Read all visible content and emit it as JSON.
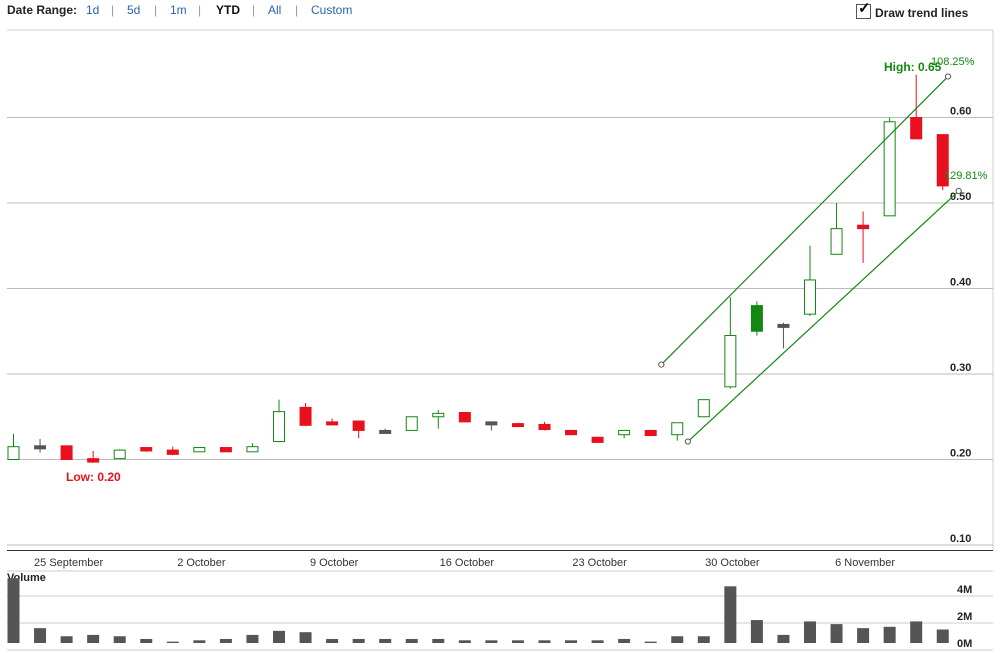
{
  "toolbar": {
    "date_range_label": "Date Range:",
    "ranges": [
      {
        "label": "1d"
      },
      {
        "label": "5d"
      },
      {
        "label": "1m"
      },
      {
        "label": "YTD",
        "active": true
      },
      {
        "label": "All"
      },
      {
        "label": "Custom"
      }
    ],
    "trend_toggle_label": "Draw trend lines",
    "trend_toggle_checked": true
  },
  "colors": {
    "up": "#118811",
    "down": "#e8101c",
    "flat": "#555555",
    "grid": "#bbbbbb",
    "volume": "#555555",
    "trend": "#118811"
  },
  "chart_data": {
    "type": "candlestick",
    "volume_label": "Volume",
    "price_axis": {
      "ticks": [
        "0.60",
        "0.50",
        "0.40",
        "0.30",
        "0.20",
        "0.10"
      ],
      "ylim": [
        0.1,
        0.7
      ]
    },
    "volume_axis": {
      "ticks": [
        "4M",
        "2M",
        "0M"
      ],
      "ylim": [
        0,
        5
      ]
    },
    "x_labels": [
      "25 September",
      "2 October",
      "9 October",
      "16 October",
      "23 October",
      "30 October",
      "6 November"
    ],
    "low_label": "Low: 0.20",
    "high_label": "High: 0.65",
    "annotations": [
      "108.25%",
      "129.81%"
    ],
    "trend_lines": [
      {
        "from": {
          "day": 24.4,
          "price": 0.311
        },
        "to": {
          "day": 35.2,
          "price": 0.648
        }
      },
      {
        "from": {
          "day": 25.4,
          "price": 0.221
        },
        "to": {
          "day": 35.6,
          "price": 0.514
        }
      }
    ],
    "candles": [
      {
        "o": 0.2,
        "h": 0.23,
        "l": 0.2,
        "c": 0.215,
        "v": 4.8
      },
      {
        "o": 0.216,
        "h": 0.224,
        "l": 0.208,
        "c": 0.216,
        "v": 1.1
      },
      {
        "o": 0.216,
        "h": 0.216,
        "l": 0.2,
        "c": 0.2,
        "v": 0.5
      },
      {
        "o": 0.201,
        "h": 0.21,
        "l": 0.196,
        "c": 0.197,
        "v": 0.6
      },
      {
        "o": 0.201,
        "h": 0.212,
        "l": 0.201,
        "c": 0.211,
        "v": 0.5
      },
      {
        "o": 0.214,
        "h": 0.214,
        "l": 0.209,
        "c": 0.21,
        "v": 0.3
      },
      {
        "o": 0.211,
        "h": 0.215,
        "l": 0.205,
        "c": 0.206,
        "v": 0.1
      },
      {
        "o": 0.209,
        "h": 0.214,
        "l": 0.209,
        "c": 0.214,
        "v": 0.2
      },
      {
        "o": 0.214,
        "h": 0.214,
        "l": 0.209,
        "c": 0.209,
        "v": 0.3
      },
      {
        "o": 0.209,
        "h": 0.219,
        "l": 0.209,
        "c": 0.215,
        "v": 0.6
      },
      {
        "o": 0.221,
        "h": 0.27,
        "l": 0.22,
        "c": 0.256,
        "v": 0.9
      },
      {
        "o": 0.261,
        "h": 0.266,
        "l": 0.239,
        "c": 0.24,
        "v": 0.8
      },
      {
        "o": 0.244,
        "h": 0.248,
        "l": 0.241,
        "c": 0.241,
        "v": 0.3
      },
      {
        "o": 0.245,
        "h": 0.245,
        "l": 0.225,
        "c": 0.234,
        "v": 0.3
      },
      {
        "o": 0.234,
        "h": 0.236,
        "l": 0.231,
        "c": 0.234,
        "v": 0.3
      },
      {
        "o": 0.234,
        "h": 0.25,
        "l": 0.234,
        "c": 0.25,
        "v": 0.3
      },
      {
        "o": 0.25,
        "h": 0.258,
        "l": 0.236,
        "c": 0.254,
        "v": 0.3
      },
      {
        "o": 0.255,
        "h": 0.255,
        "l": 0.244,
        "c": 0.244,
        "v": 0.2
      },
      {
        "o": 0.244,
        "h": 0.244,
        "l": 0.234,
        "c": 0.244,
        "v": 0.2
      },
      {
        "o": 0.242,
        "h": 0.243,
        "l": 0.238,
        "c": 0.24,
        "v": 0.2
      },
      {
        "o": 0.241,
        "h": 0.244,
        "l": 0.234,
        "c": 0.235,
        "v": 0.2
      },
      {
        "o": 0.234,
        "h": 0.234,
        "l": 0.229,
        "c": 0.229,
        "v": 0.2
      },
      {
        "o": 0.226,
        "h": 0.226,
        "l": 0.22,
        "c": 0.22,
        "v": 0.2
      },
      {
        "o": 0.229,
        "h": 0.234,
        "l": 0.225,
        "c": 0.234,
        "v": 0.3
      },
      {
        "o": 0.234,
        "h": 0.234,
        "l": 0.228,
        "c": 0.228,
        "v": 0.1
      },
      {
        "o": 0.229,
        "h": 0.243,
        "l": 0.222,
        "c": 0.243,
        "v": 0.5
      },
      {
        "o": 0.25,
        "h": 0.27,
        "l": 0.25,
        "c": 0.27,
        "v": 0.5
      },
      {
        "o": 0.285,
        "h": 0.39,
        "l": 0.283,
        "c": 0.345,
        "v": 4.2
      },
      {
        "o": 0.38,
        "h": 0.385,
        "l": 0.345,
        "c": 0.35,
        "v": 1.7
      },
      {
        "o": 0.358,
        "h": 0.36,
        "l": 0.33,
        "c": 0.358,
        "v": 0.6
      },
      {
        "o": 0.37,
        "h": 0.45,
        "l": 0.368,
        "c": 0.41,
        "v": 1.6
      },
      {
        "o": 0.44,
        "h": 0.5,
        "l": 0.44,
        "c": 0.47,
        "v": 1.4
      },
      {
        "o": 0.474,
        "h": 0.49,
        "l": 0.43,
        "c": 0.47,
        "v": 1.1
      },
      {
        "o": 0.485,
        "h": 0.6,
        "l": 0.485,
        "c": 0.595,
        "v": 1.2
      },
      {
        "o": 0.6,
        "h": 0.65,
        "l": 0.575,
        "c": 0.575,
        "v": 1.6
      },
      {
        "o": 0.58,
        "h": 0.58,
        "l": 0.515,
        "c": 0.52,
        "v": 1.0
      }
    ]
  }
}
